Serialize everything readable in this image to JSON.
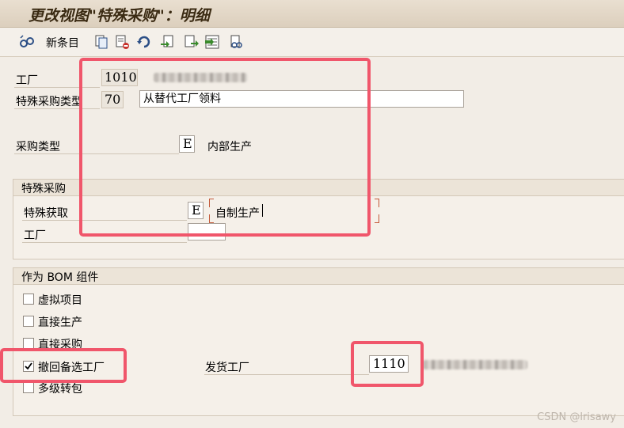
{
  "window": {
    "title": "更改视图\"特殊采购\"：明细"
  },
  "toolbar": {
    "new_entries_label": "新条目",
    "icons": [
      "glasses-icon",
      "copy-icon",
      "delete-icon",
      "undo-icon",
      "select-all-icon",
      "export-icon",
      "deselect-icon",
      "print-icon"
    ]
  },
  "header": {
    "plant_label": "工厂",
    "plant_value": "1010",
    "special_procurement_type_label": "特殊采购类型",
    "special_procurement_type_value": "70",
    "special_procurement_type_desc": "从替代工厂领料",
    "procurement_type_label": "采购类型",
    "procurement_type_value": "E",
    "procurement_type_desc": "内部生产"
  },
  "special_procurement_group": {
    "title": "特殊采购",
    "special_acquisition_label": "特殊获取",
    "special_acquisition_value": "E",
    "special_acquisition_desc": "自制生产",
    "plant_label": "工厂",
    "plant_value": ""
  },
  "bom_group": {
    "title": "作为 BOM 组件",
    "phantom_item_label": "虚拟项目",
    "phantom_item_checked": false,
    "direct_production_label": "直接生产",
    "direct_production_checked": false,
    "direct_procurement_label": "直接采购",
    "direct_procurement_checked": false,
    "withdraw_alt_plant_label": "撤回备选工厂",
    "withdraw_alt_plant_checked": true,
    "issuing_plant_label": "发货工厂",
    "issuing_plant_value": "1110",
    "multilevel_label": "多级转包",
    "multilevel_checked": false
  },
  "watermark": "CSDN @lrisawy",
  "colors": {
    "annotation_red": "#f0566b",
    "title_text": "#3a2a12",
    "background": "#f2ede6"
  }
}
